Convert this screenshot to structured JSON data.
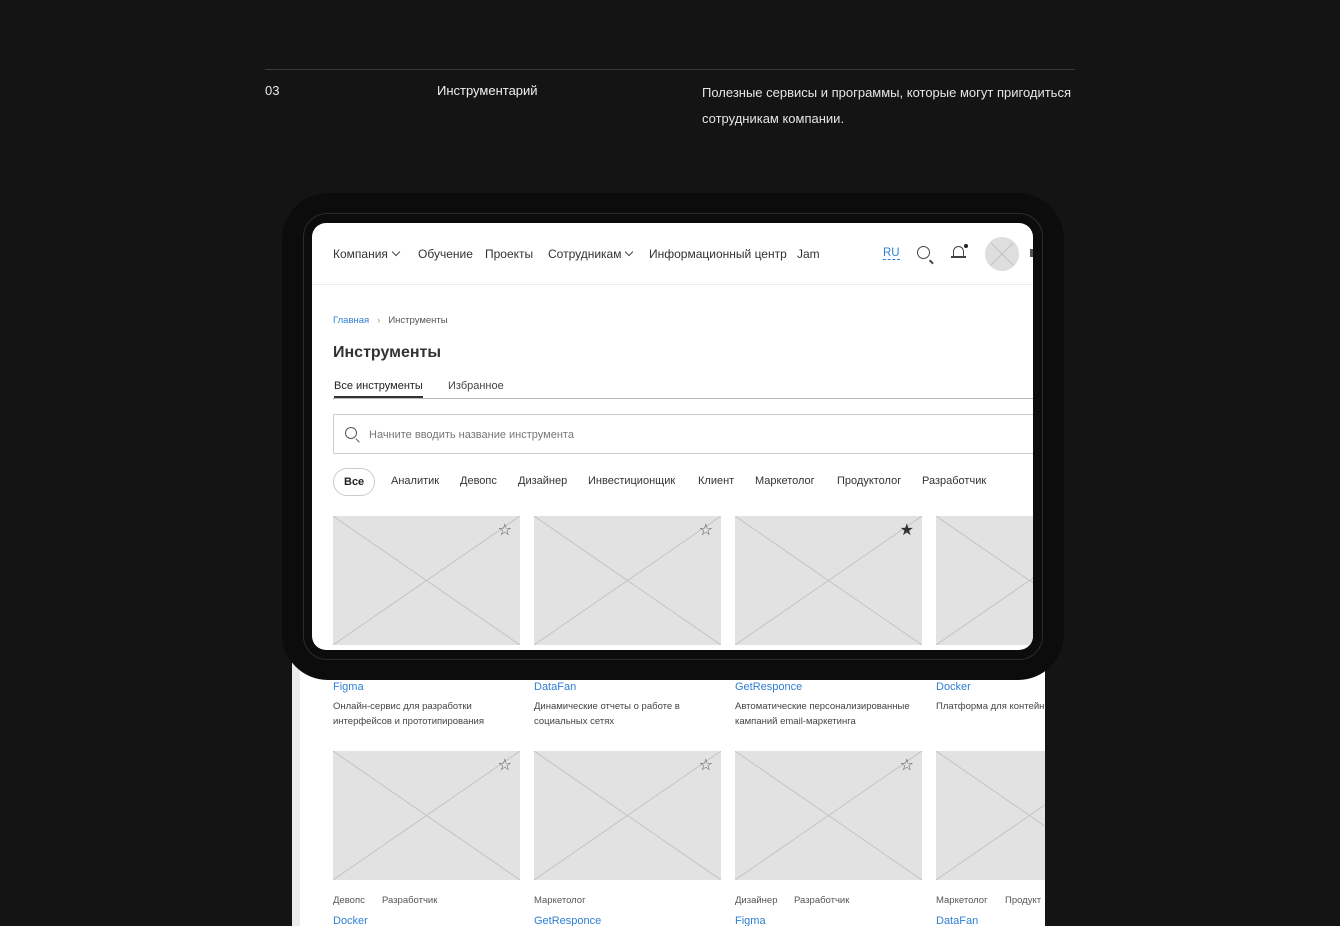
{
  "section": {
    "number": "03",
    "title": "Инструментарий",
    "description": "Полезные сервисы и программы, которые могут пригодиться сотрудникам компании."
  },
  "nav": {
    "items": [
      {
        "label": "Компания",
        "dropdown": true
      },
      {
        "label": "Обучение",
        "dropdown": false
      },
      {
        "label": "Проекты",
        "dropdown": false
      },
      {
        "label": "Сотрудникам",
        "dropdown": true
      },
      {
        "label": "Информационный центр",
        "dropdown": false
      },
      {
        "label": "Jam",
        "dropdown": false
      }
    ],
    "lang": "RU"
  },
  "breadcrumb": {
    "home": "Главная",
    "current": "Инструменты"
  },
  "page_title": "Инструменты",
  "tabs": [
    {
      "label": "Все инструменты",
      "active": true
    },
    {
      "label": "Избранное",
      "active": false
    }
  ],
  "search": {
    "placeholder": "Начните вводить название инструмента"
  },
  "filters": [
    "Все",
    "Аналитик",
    "Девопс",
    "Дизайнер",
    "Инвестиционщик",
    "Клиент",
    "Маркетолог",
    "Продуктолог",
    "Разработчик"
  ],
  "cards_row1": [
    {
      "title": "Figma",
      "desc": "Онлайн-сервис для разработки интерфейсов и прототипирования",
      "favorite": false
    },
    {
      "title": "DataFan",
      "desc": "Динамические отчеты о работе в социальных сетях",
      "favorite": false
    },
    {
      "title": "GetResponce",
      "desc": "Автоматические персонализированные кампаний email-маркетинга",
      "favorite": true
    },
    {
      "title": "Docker",
      "desc": "Платформа для контейн",
      "favorite": false
    }
  ],
  "cards_row2": [
    {
      "tags": [
        "Девопс",
        "Разработчик"
      ],
      "title": "Docker",
      "favorite": false
    },
    {
      "tags": [
        "Маркетолог"
      ],
      "title": "GetResponce",
      "favorite": false
    },
    {
      "tags": [
        "Дизайнер",
        "Разработчик"
      ],
      "title": "Figma",
      "favorite": false
    },
    {
      "tags": [
        "Маркетолог",
        "Продукт"
      ],
      "title": "DataFan",
      "favorite": false
    }
  ],
  "colors": {
    "background": "#141414",
    "accent": "#2f7fd4",
    "placeholder": "#e2e2e2"
  }
}
